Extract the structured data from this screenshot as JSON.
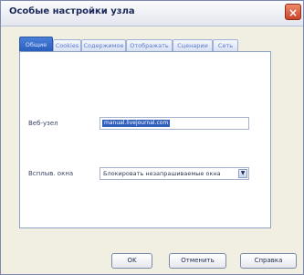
{
  "window": {
    "title": "Особые настройки узла",
    "close_glyph": "×"
  },
  "tabs": [
    {
      "label": "Общие",
      "active": true
    },
    {
      "label": "Cookies",
      "active": false
    },
    {
      "label": "Содержимое",
      "active": false
    },
    {
      "label": "Отображать",
      "active": false
    },
    {
      "label": "Сценарии",
      "active": false
    },
    {
      "label": "Сеть",
      "active": false
    }
  ],
  "form": {
    "site_label": "Веб-узел",
    "site_value": "manual.livejournal.com",
    "popups_label": "Всплыв. окна",
    "popups_value": "Блокировать незапрашиваемые окна"
  },
  "buttons": {
    "ok": "OK",
    "cancel": "Отменить",
    "help": "Справка"
  },
  "icons": {
    "close": "close-icon",
    "dropdown": "chevron-down-icon"
  }
}
